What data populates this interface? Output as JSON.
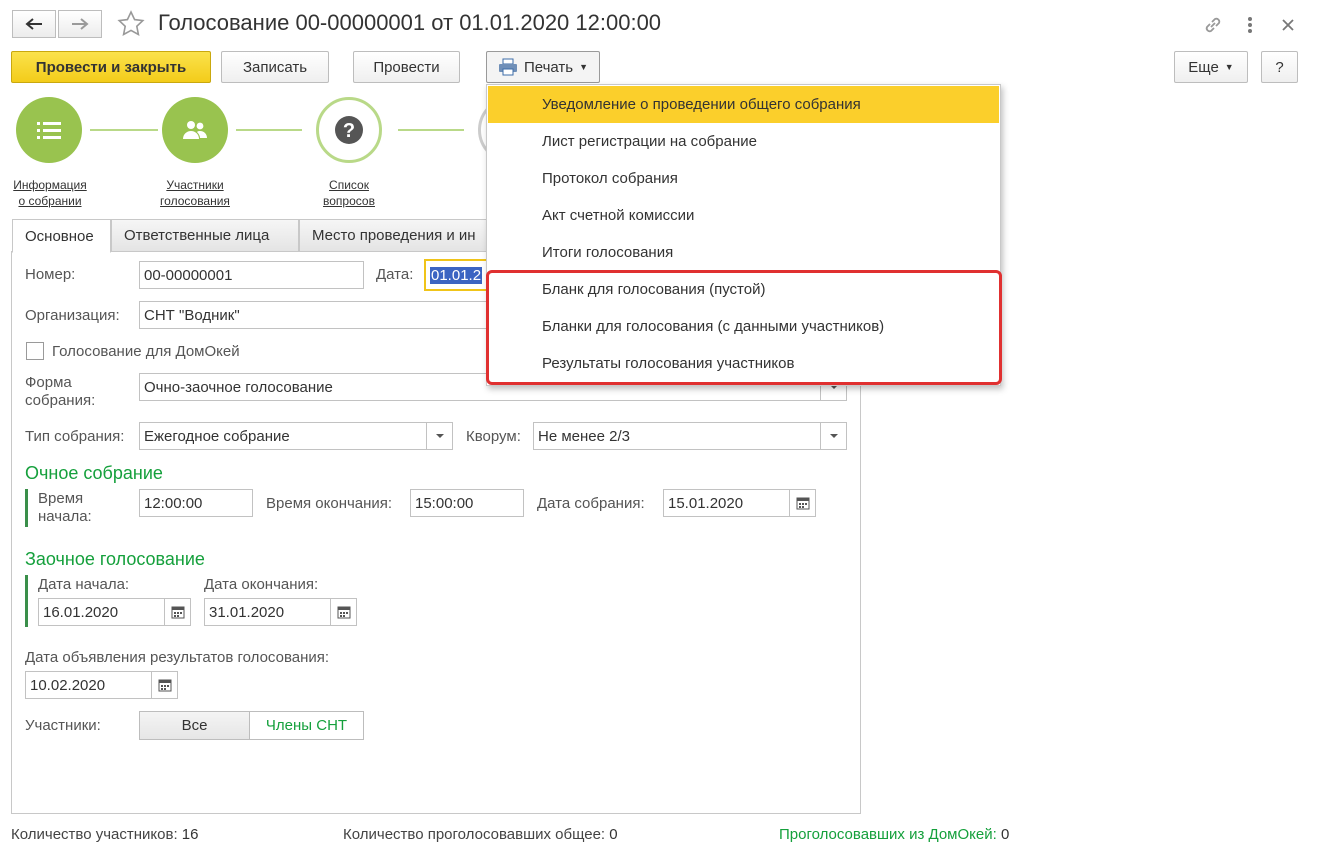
{
  "window": {
    "title": "Голосование 00-00000001 от 01.01.2020 12:00:00"
  },
  "toolbar": {
    "post_close_label": "Провести и закрыть",
    "save_label": "Записать",
    "post_label": "Провести",
    "print_label": "Печать",
    "more_label": "Еще",
    "help_label": "?"
  },
  "steps": [
    {
      "label_line1": "Информация",
      "label_line2": "о собрании"
    },
    {
      "label_line1": "Участники",
      "label_line2": "голосования"
    },
    {
      "label_line1": "Список",
      "label_line2": "вопросов"
    }
  ],
  "tabs": [
    {
      "label": "Основное"
    },
    {
      "label": "Ответственные лица"
    },
    {
      "label": "Место проведения и ин"
    }
  ],
  "form": {
    "number_label": "Номер:",
    "number_value": "00-00000001",
    "date_label": "Дата:",
    "date_value": "01.01.2",
    "org_label": "Организация:",
    "org_value": "СНТ \"Водник\"",
    "domokey_label": "Голосование для ДомОкей",
    "form_label_line1": "Форма",
    "form_label_line2": "собрания:",
    "form_value": "Очно-заочное голосование",
    "type_label": "Тип собрания:",
    "type_value": "Ежегодное собрание",
    "quorum_label": "Кворум:",
    "quorum_value": "Не менее 2/3",
    "in_person_title": "Очное собрание",
    "start_time_label_line1": "Время",
    "start_time_label_line2": "начала:",
    "start_time_value": "12:00:00",
    "end_time_label": "Время окончания:",
    "end_time_value": "15:00:00",
    "meeting_date_label": "Дата собрания:",
    "meeting_date_value": "15.01.2020",
    "absentee_title": "Заочное голосование",
    "abs_start_label": "Дата начала:",
    "abs_start_value": "16.01.2020",
    "abs_end_label": "Дата окончания:",
    "abs_end_value": "31.01.2020",
    "results_date_label": "Дата объявления результатов голосования:",
    "results_date_value": "10.02.2020",
    "participants_label": "Участники:",
    "participants_all": "Все",
    "participants_members": "Члены СНТ"
  },
  "print_menu": {
    "items": [
      {
        "label": "Уведомление о проведении общего собрания"
      },
      {
        "label": "Лист регистрации на собрание"
      },
      {
        "label": "Протокол собрания"
      },
      {
        "label": "Акт счетной комиссии"
      },
      {
        "label": "Итоги голосования"
      },
      {
        "label": "Бланк для голосования (пустой)"
      },
      {
        "label": "Бланки для голосования (с данными участников)"
      },
      {
        "label": "Результаты голосования участников"
      }
    ]
  },
  "footer": {
    "participants_label": "Количество участников:",
    "participants_value": "16",
    "voted_total_label": "Количество проголосовавших общее:",
    "voted_total_value": "0",
    "voted_domokey_label": "Проголосовавших  из ДомОкей:",
    "voted_domokey_value": "0"
  },
  "colors": {
    "primary_button": "#f3cc1a",
    "step_green": "#99c34f",
    "section_green": "#15a03c",
    "menu_highlight": "#fbcf2b",
    "annotation_red": "#e03030"
  },
  "icons": {
    "back": "arrow-left-icon",
    "forward": "arrow-right-icon",
    "favorite": "star-icon",
    "link": "link-icon",
    "more": "vertical-dots-icon",
    "close": "close-icon",
    "print": "printer-icon"
  }
}
